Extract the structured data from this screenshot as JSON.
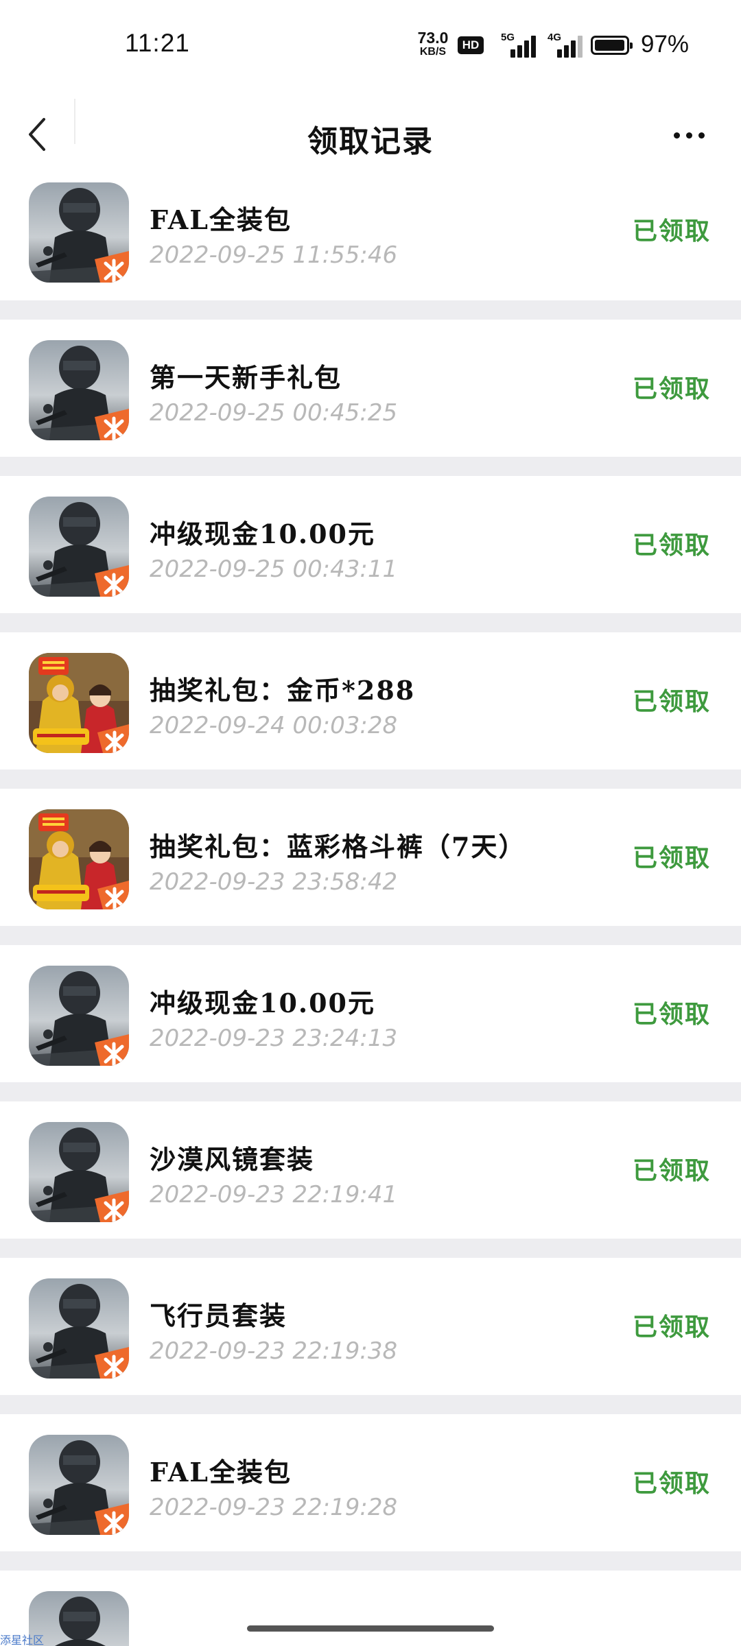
{
  "status_bar": {
    "time": "11:21",
    "net_speed_value": "73.0",
    "net_speed_unit": "KB/S",
    "hd_badge": "HD",
    "signal_1_tag": "5G",
    "signal_2_tag": "4G",
    "battery_percent": "97%",
    "battery_level": 0.97
  },
  "nav": {
    "title": "领取记录",
    "back_icon": "chevron-left-icon",
    "more_icon": "more-horizontal-icon"
  },
  "colors": {
    "status_green": "#3e9a3e",
    "time_gray": "#b8b8b8",
    "separator": "#ededf0"
  },
  "records": [
    {
      "title": "FAL全装包",
      "time": "2022-09-25 11:55:46",
      "status": "已领取",
      "icon": "game-icon-soldier"
    },
    {
      "title": "第一天新手礼包",
      "time": "2022-09-25 00:45:25",
      "status": "已领取",
      "icon": "game-icon-soldier"
    },
    {
      "title": "冲级现金10.00元",
      "time": "2022-09-25 00:43:11",
      "status": "已领取",
      "icon": "game-icon-soldier"
    },
    {
      "title": "抽奖礼包：金币*288",
      "time": "2022-09-24 00:03:28",
      "status": "已领取",
      "icon": "game-icon-yellow"
    },
    {
      "title": "抽奖礼包：蓝彩格斗裤（7天）",
      "time": "2022-09-23 23:58:42",
      "status": "已领取",
      "icon": "game-icon-yellow"
    },
    {
      "title": "冲级现金10.00元",
      "time": "2022-09-23 23:24:13",
      "status": "已领取",
      "icon": "game-icon-soldier"
    },
    {
      "title": "沙漠风镜套装",
      "time": "2022-09-23 22:19:41",
      "status": "已领取",
      "icon": "game-icon-soldier"
    },
    {
      "title": "飞行员套装",
      "time": "2022-09-23 22:19:38",
      "status": "已领取",
      "icon": "game-icon-soldier"
    },
    {
      "title": "FAL全装包",
      "time": "2022-09-23 22:19:28",
      "status": "已领取",
      "icon": "game-icon-soldier"
    }
  ],
  "watermark": "添星社区"
}
